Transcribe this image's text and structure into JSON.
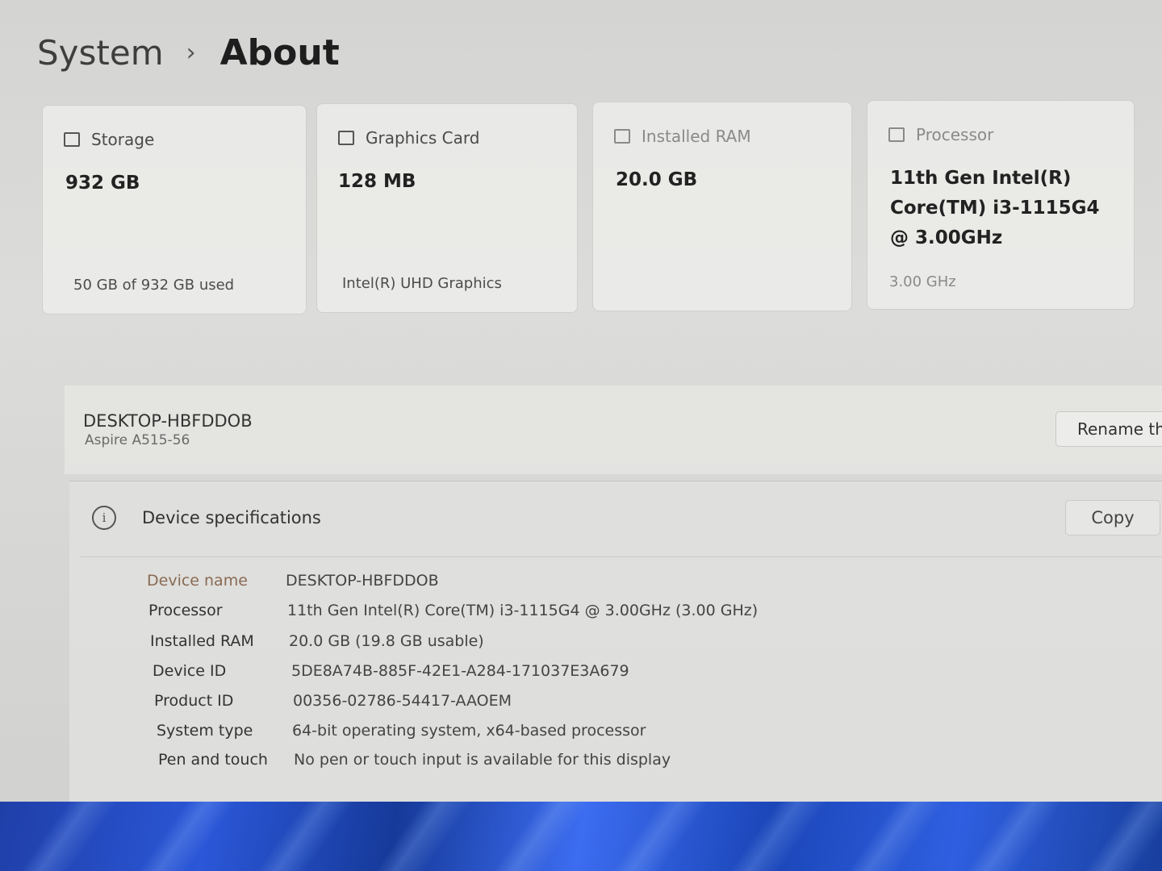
{
  "breadcrumb": {
    "root": "System",
    "separator": "›",
    "current": "About"
  },
  "cards": [
    {
      "label": "Storage",
      "icon": "storage-icon",
      "value": "932 GB",
      "sub": "50 GB of 932 GB used"
    },
    {
      "label": "Graphics Card",
      "icon": "graphics-card-icon",
      "value": "128 MB",
      "sub": "Intel(R) UHD Graphics"
    },
    {
      "label": "Installed RAM",
      "icon": "ram-icon",
      "value": "20.0 GB",
      "sub": ""
    },
    {
      "label": "Processor",
      "icon": "processor-icon",
      "value": "11th Gen Intel(R) Core(TM) i3-1115G4 @ 3.00GHz",
      "sub": "3.00 GHz"
    }
  ],
  "device": {
    "name": "DESKTOP-HBFDDOB",
    "model": "Aspire A515-56",
    "rename_label": "Rename th"
  },
  "specs": {
    "title": "Device specifications",
    "copy_label": "Copy",
    "rows": [
      {
        "label": "Device name",
        "value": "DESKTOP-HBFDDOB"
      },
      {
        "label": "Processor",
        "value": "11th Gen Intel(R) Core(TM) i3-1115G4 @ 3.00GHz (3.00 GHz)"
      },
      {
        "label": "Installed RAM",
        "value": "20.0 GB (19.8 GB usable)"
      },
      {
        "label": "Device ID",
        "value": "5DE8A74B-885F-42E1-A284-171037E3A679"
      },
      {
        "label": "Product ID",
        "value": "00356-02786-54417-AAOEM"
      },
      {
        "label": "System type",
        "value": "64-bit operating system, x64-based processor"
      },
      {
        "label": "Pen and touch",
        "value": "No pen or touch input is available for this display"
      }
    ]
  }
}
